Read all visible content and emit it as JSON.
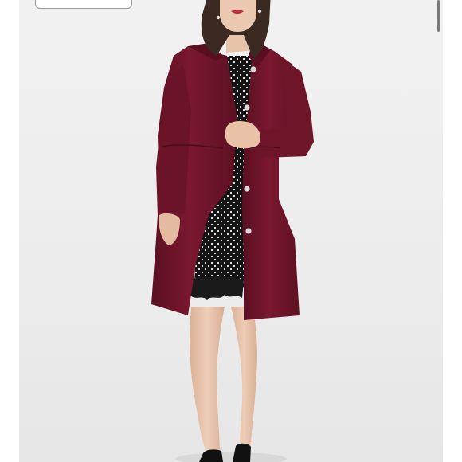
{
  "image": {
    "subject": "",
    "colors": {
      "background": "#eeeeee",
      "coat": "#6e1428",
      "coat_shadow": "#4c0d1b",
      "coat_highlight": "#8a2138",
      "dress": "#141414",
      "dress_dots": "#f2f2f2",
      "skin": "#e7c3a9",
      "hair": "#3a2a22",
      "shoe": "#111111",
      "button": "#d9d9d9"
    }
  }
}
